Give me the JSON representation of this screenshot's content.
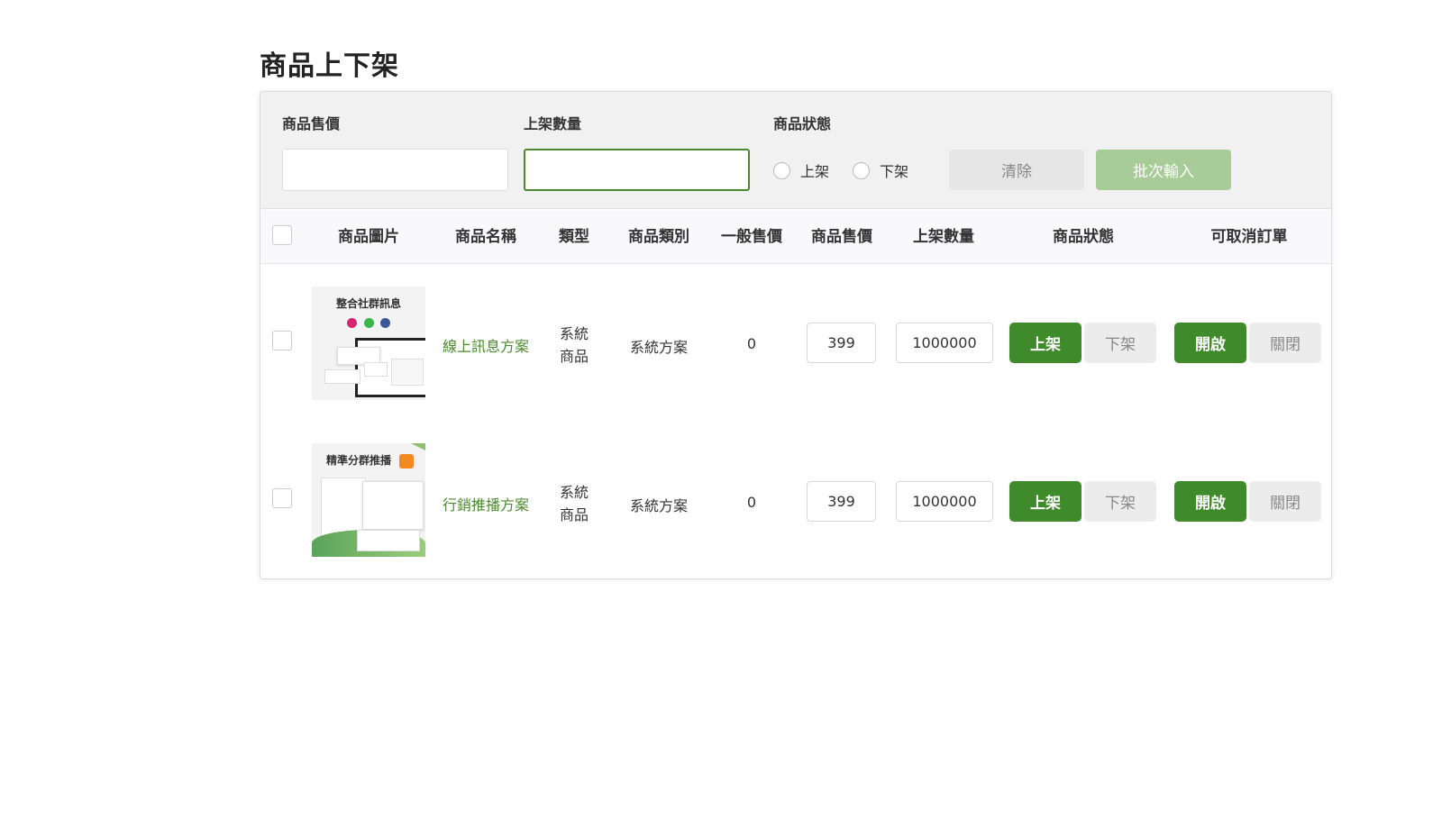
{
  "page": {
    "title": "商品上下架"
  },
  "filters": {
    "price_label": "商品售價",
    "price_value": "",
    "quantity_label": "上架數量",
    "quantity_value": "",
    "status_label": "商品狀態",
    "status_options": [
      "上架",
      "下架"
    ],
    "clear_label": "清除",
    "batch_label": "批次輸入"
  },
  "table": {
    "columns": [
      "商品圖片",
      "商品名稱",
      "類型",
      "商品類別",
      "一般售價",
      "商品售價",
      "上架數量",
      "商品狀態",
      "可取消訂單"
    ],
    "rows": [
      {
        "image_title": "整合社群訊息",
        "name": "線上訊息方案",
        "type": "系統商品",
        "category": "系統方案",
        "regular_price": "0",
        "sale_price": "399",
        "quantity": "1000000",
        "status_on": "上架",
        "status_off": "下架",
        "cancel_on": "開啟",
        "cancel_off": "關閉"
      },
      {
        "image_title": "精準分群推播",
        "name": "行銷推播方案",
        "type": "系統商品",
        "category": "系統方案",
        "regular_price": "0",
        "sale_price": "399",
        "quantity": "1000000",
        "status_on": "上架",
        "status_off": "下架",
        "cancel_on": "開啟",
        "cancel_off": "關閉"
      }
    ]
  },
  "colors": {
    "accent": "#3f8a2a",
    "accent_light": "#a8cc98",
    "link": "#4a8a2e"
  }
}
